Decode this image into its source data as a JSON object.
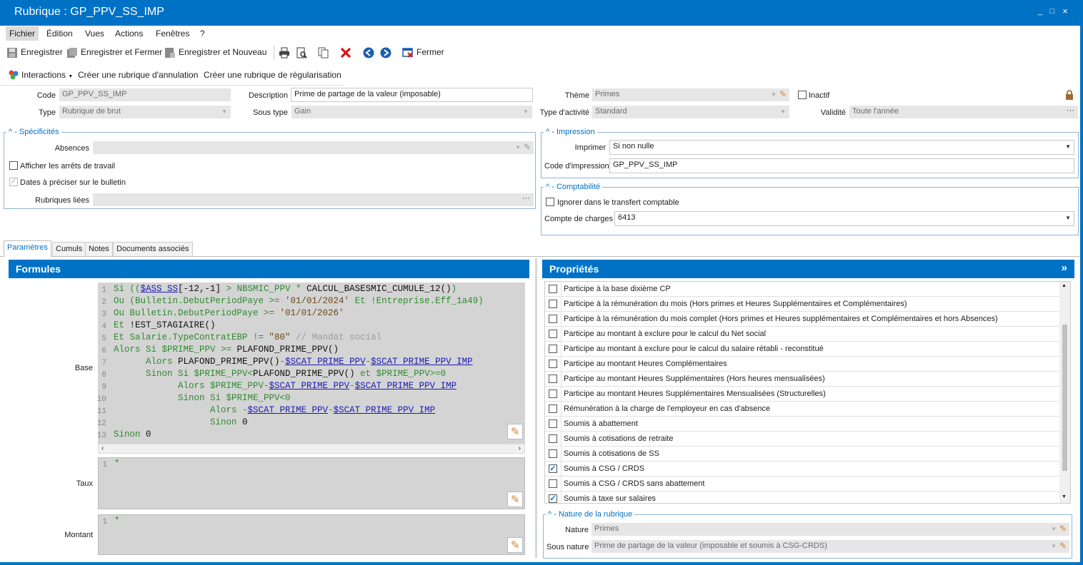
{
  "window": {
    "title": "Rubrique : GP_PPV_SS_IMP",
    "controls": [
      "_",
      "□",
      "×"
    ]
  },
  "menu": [
    "Fichier",
    "Édition",
    "Vues",
    "Actions",
    "Fenêtres",
    "?"
  ],
  "toolbar": {
    "save": "Enregistrer",
    "save_close": "Enregistrer et Fermer",
    "save_new": "Enregistrer et Nouveau",
    "close": "Fermer"
  },
  "interactions": {
    "menu": "Interactions",
    "cancel_rubric": "Créer une rubrique d'annulation",
    "regul_rubric": "Créer une rubrique de régularisation"
  },
  "header": {
    "code_label": "Code",
    "code_value": "GP_PPV_SS_IMP",
    "type_label": "Type",
    "type_value": "Rubrique de brut",
    "desc_label": "Description",
    "desc_value": "Prime de partage de la valeur (imposable)",
    "soustype_label": "Sous type",
    "soustype_value": "Gain",
    "theme_label": "Thème",
    "theme_value": "Primes",
    "activite_label": "Type d'activité",
    "activite_value": "Standard",
    "inactif_label": "Inactif",
    "validite_label": "Validité",
    "validite_value": "Toute l'année"
  },
  "specificites": {
    "title": "Spécificités",
    "absences_label": "Absences",
    "arrets_label": "Afficher les arrêts de travail",
    "dates_label": "Dates à préciser sur le bulletin",
    "liees_label": "Rubriques liées"
  },
  "impression": {
    "title": "Impression",
    "imprimer_label": "Imprimer",
    "imprimer_value": "Si non nulle",
    "code_label": "Code d'impression",
    "code_value": "GP_PPV_SS_IMP"
  },
  "comptabilite": {
    "title": "Comptabilité",
    "ignorer_label": "Ignorer dans le transfert comptable",
    "compte_label": "Compte de charges",
    "compte_value": "6413"
  },
  "tabs": [
    "Paramètres",
    "Cumuls",
    "Notes",
    "Documents associés"
  ],
  "formules": {
    "title": "Formules",
    "base_label": "Base",
    "taux_label": "Taux",
    "montant_label": "Montant",
    "line_numbers": [
      "1",
      "2",
      "3",
      "4",
      "5",
      "6",
      "7",
      "8",
      "9",
      "10",
      "11",
      "12",
      "13"
    ],
    "base_lines": [
      [
        [
          "kw",
          "Si (("
        ],
        [
          "vr",
          "$ASS_SS"
        ],
        [
          "fn",
          "[-12,-1] "
        ],
        [
          "kw",
          "> NBSMIC_PPV * "
        ],
        [
          "fn",
          "CALCUL_BASESMIC_CUMULE_12()"
        ],
        [
          "kw",
          ")"
        ]
      ],
      [
        [
          "kw",
          "Ou (Bulletin.DebutPeriodPaye >= "
        ],
        [
          "st",
          "'01/01/2024'"
        ],
        [
          "kw",
          " Et !Entreprise.Eff_1a49)"
        ]
      ],
      [
        [
          "kw",
          "Ou Bulletin.DebutPeriodPaye >= "
        ],
        [
          "st",
          "'01/01/2026'"
        ]
      ],
      [
        [
          "kw",
          "Et "
        ],
        [
          "fn",
          "!EST_STAGIAIRE()"
        ]
      ],
      [
        [
          "kw",
          "Et Salarie.TypeContratEBP != "
        ],
        [
          "st",
          "\"80\""
        ],
        [
          "cm",
          " // Mandat social"
        ]
      ],
      [
        [
          "kw",
          "Alors Si $PRIME_PPV >= "
        ],
        [
          "fn",
          "PLAFOND_PRIME_PPV()"
        ]
      ],
      [
        [
          "kw",
          "      Alors "
        ],
        [
          "fn",
          "PLAFOND_PRIME_PPV()"
        ],
        [
          "kw",
          "-"
        ],
        [
          "vr",
          "$SCAT_PRIME_PPV"
        ],
        [
          "kw",
          "-"
        ],
        [
          "vr",
          "$SCAT_PRIME_PPV_IMP"
        ]
      ],
      [
        [
          "kw",
          "      Sinon Si $PRIME_PPV<"
        ],
        [
          "fn",
          "PLAFOND_PRIME_PPV()"
        ],
        [
          "kw",
          " et $PRIME_PPV>=0"
        ]
      ],
      [
        [
          "kw",
          "            Alors $PRIME_PPV-"
        ],
        [
          "vr",
          "$SCAT_PRIME_PPV"
        ],
        [
          "kw",
          "-"
        ],
        [
          "vr",
          "$SCAT_PRIME_PPV_IMP"
        ]
      ],
      [
        [
          "kw",
          "            Sinon Si $PRIME_PPV<0"
        ]
      ],
      [
        [
          "kw",
          "                  Alors -"
        ],
        [
          "vr",
          "$SCAT_PRIME_PPV"
        ],
        [
          "kw",
          "-"
        ],
        [
          "vr",
          "$SCAT_PRIME_PPV_IMP"
        ]
      ],
      [
        [
          "kw",
          "                  Sinon "
        ],
        [
          "fn",
          "0"
        ]
      ],
      [
        [
          "kw",
          "Sinon "
        ],
        [
          "fn",
          "0"
        ]
      ]
    ],
    "taux_line": "*",
    "montant_line": "*",
    "taux_ln": "1",
    "montant_ln": "1"
  },
  "proprietes": {
    "title": "Propriétés",
    "items": [
      {
        "label": "Participe à la base dixième CP",
        "checked": false
      },
      {
        "label": "Participe à la rémunération du mois (Hors primes et Heures Supplémentaires et Complémentaires)",
        "checked": false
      },
      {
        "label": "Participe à la rémunération du mois complet (Hors primes et Heures supplémentaires et Complémentaires et hors Absences)",
        "checked": false
      },
      {
        "label": "Participe au montant à exclure pour le calcul du Net social",
        "checked": false
      },
      {
        "label": "Participe au montant à exclure pour le calcul du salaire rétabli - reconstitué",
        "checked": false
      },
      {
        "label": "Participe au montant Heures Complémentaires",
        "checked": false
      },
      {
        "label": "Participe au montant Heures Supplémentaires (Hors heures mensualisées)",
        "checked": false
      },
      {
        "label": "Participe au montant Heures Supplémentaires Mensualisées (Structurelles)",
        "checked": false
      },
      {
        "label": "Rémunération à la charge de l'employeur en cas d'absence",
        "checked": false
      },
      {
        "label": "Soumis à abattement",
        "checked": false
      },
      {
        "label": "Soumis à cotisations de retraite",
        "checked": false
      },
      {
        "label": "Soumis à cotisations de SS",
        "checked": false
      },
      {
        "label": "Soumis à CSG / CRDS",
        "checked": true
      },
      {
        "label": "Soumis à CSG / CRDS sans abattement",
        "checked": false
      },
      {
        "label": "Soumis à taxe sur salaires",
        "checked": true
      }
    ]
  },
  "nature": {
    "title": "Nature de la rubrique",
    "nature_label": "Nature",
    "nature_value": "Primes",
    "sousnature_label": "Sous nature",
    "sousnature_value": "Prime de partage de la valeur (imposable et soumis à CSG-CRDS)"
  }
}
